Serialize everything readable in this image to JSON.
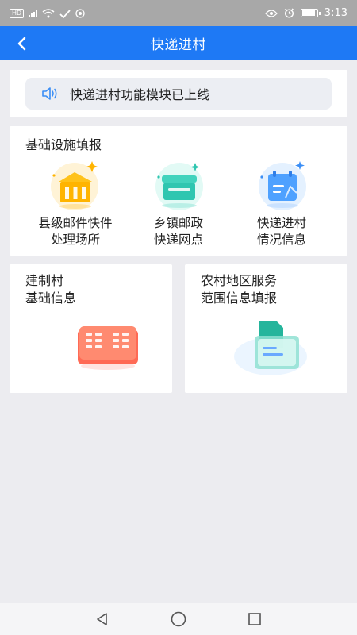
{
  "status_bar": {
    "left_badge_hd": "HD",
    "time": "3:13",
    "battery_level": 0.9
  },
  "header": {
    "title": "快递进村",
    "back_icon": "chevron-left-icon"
  },
  "notice": {
    "icon": "speaker-icon",
    "text": "快递进村功能模块已上线"
  },
  "facilities": {
    "title": "基础设施填报",
    "items": [
      {
        "line1": "县级邮件快件",
        "line2": "处理场所",
        "icon": "building-icon"
      },
      {
        "line1": "乡镇邮政",
        "line2": "快递网点",
        "icon": "shop-icon"
      },
      {
        "line1": "快递进村",
        "line2": "情况信息",
        "icon": "calendar-chart-icon"
      }
    ]
  },
  "cards": [
    {
      "line1": "建制村",
      "line2": "基础信息",
      "icon": "book-grid-icon"
    },
    {
      "line1": "农村地区服务",
      "line2": "范围信息填报",
      "icon": "folder-doc-icon"
    }
  ],
  "nav": {
    "back": "triangle-back-icon",
    "home": "circle-home-icon",
    "recent": "square-recent-icon"
  },
  "colors": {
    "primary": "#1e79f5",
    "page_bg": "#ececf0",
    "orange": "#ffb400",
    "teal": "#2fc6b0",
    "blue_icon": "#4ea1ff",
    "red_icon": "#ff5a4a"
  }
}
